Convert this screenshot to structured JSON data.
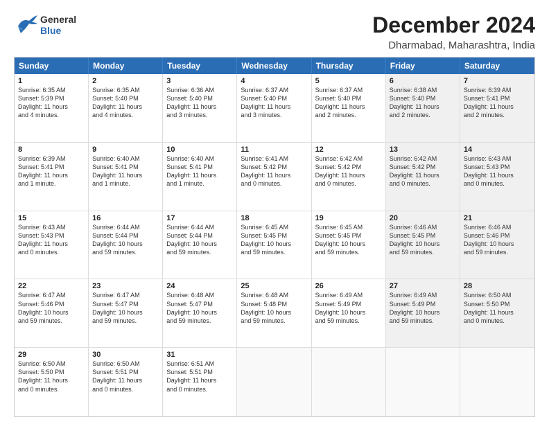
{
  "header": {
    "logo_general": "General",
    "logo_blue": "Blue",
    "main_title": "December 2024",
    "subtitle": "Dharmabad, Maharashtra, India"
  },
  "calendar": {
    "days_of_week": [
      "Sunday",
      "Monday",
      "Tuesday",
      "Wednesday",
      "Thursday",
      "Friday",
      "Saturday"
    ],
    "weeks": [
      [
        {
          "day": "1",
          "lines": [
            "Sunrise: 6:35 AM",
            "Sunset: 5:39 PM",
            "Daylight: 11 hours",
            "and 4 minutes."
          ],
          "shaded": false
        },
        {
          "day": "2",
          "lines": [
            "Sunrise: 6:35 AM",
            "Sunset: 5:40 PM",
            "Daylight: 11 hours",
            "and 4 minutes."
          ],
          "shaded": false
        },
        {
          "day": "3",
          "lines": [
            "Sunrise: 6:36 AM",
            "Sunset: 5:40 PM",
            "Daylight: 11 hours",
            "and 3 minutes."
          ],
          "shaded": false
        },
        {
          "day": "4",
          "lines": [
            "Sunrise: 6:37 AM",
            "Sunset: 5:40 PM",
            "Daylight: 11 hours",
            "and 3 minutes."
          ],
          "shaded": false
        },
        {
          "day": "5",
          "lines": [
            "Sunrise: 6:37 AM",
            "Sunset: 5:40 PM",
            "Daylight: 11 hours",
            "and 2 minutes."
          ],
          "shaded": false
        },
        {
          "day": "6",
          "lines": [
            "Sunrise: 6:38 AM",
            "Sunset: 5:40 PM",
            "Daylight: 11 hours",
            "and 2 minutes."
          ],
          "shaded": true
        },
        {
          "day": "7",
          "lines": [
            "Sunrise: 6:39 AM",
            "Sunset: 5:41 PM",
            "Daylight: 11 hours",
            "and 2 minutes."
          ],
          "shaded": true
        }
      ],
      [
        {
          "day": "8",
          "lines": [
            "Sunrise: 6:39 AM",
            "Sunset: 5:41 PM",
            "Daylight: 11 hours",
            "and 1 minute."
          ],
          "shaded": false
        },
        {
          "day": "9",
          "lines": [
            "Sunrise: 6:40 AM",
            "Sunset: 5:41 PM",
            "Daylight: 11 hours",
            "and 1 minute."
          ],
          "shaded": false
        },
        {
          "day": "10",
          "lines": [
            "Sunrise: 6:40 AM",
            "Sunset: 5:41 PM",
            "Daylight: 11 hours",
            "and 1 minute."
          ],
          "shaded": false
        },
        {
          "day": "11",
          "lines": [
            "Sunrise: 6:41 AM",
            "Sunset: 5:42 PM",
            "Daylight: 11 hours",
            "and 0 minutes."
          ],
          "shaded": false
        },
        {
          "day": "12",
          "lines": [
            "Sunrise: 6:42 AM",
            "Sunset: 5:42 PM",
            "Daylight: 11 hours",
            "and 0 minutes."
          ],
          "shaded": false
        },
        {
          "day": "13",
          "lines": [
            "Sunrise: 6:42 AM",
            "Sunset: 5:42 PM",
            "Daylight: 11 hours",
            "and 0 minutes."
          ],
          "shaded": true
        },
        {
          "day": "14",
          "lines": [
            "Sunrise: 6:43 AM",
            "Sunset: 5:43 PM",
            "Daylight: 11 hours",
            "and 0 minutes."
          ],
          "shaded": true
        }
      ],
      [
        {
          "day": "15",
          "lines": [
            "Sunrise: 6:43 AM",
            "Sunset: 5:43 PM",
            "Daylight: 11 hours",
            "and 0 minutes."
          ],
          "shaded": false
        },
        {
          "day": "16",
          "lines": [
            "Sunrise: 6:44 AM",
            "Sunset: 5:44 PM",
            "Daylight: 10 hours",
            "and 59 minutes."
          ],
          "shaded": false
        },
        {
          "day": "17",
          "lines": [
            "Sunrise: 6:44 AM",
            "Sunset: 5:44 PM",
            "Daylight: 10 hours",
            "and 59 minutes."
          ],
          "shaded": false
        },
        {
          "day": "18",
          "lines": [
            "Sunrise: 6:45 AM",
            "Sunset: 5:45 PM",
            "Daylight: 10 hours",
            "and 59 minutes."
          ],
          "shaded": false
        },
        {
          "day": "19",
          "lines": [
            "Sunrise: 6:45 AM",
            "Sunset: 5:45 PM",
            "Daylight: 10 hours",
            "and 59 minutes."
          ],
          "shaded": false
        },
        {
          "day": "20",
          "lines": [
            "Sunrise: 6:46 AM",
            "Sunset: 5:45 PM",
            "Daylight: 10 hours",
            "and 59 minutes."
          ],
          "shaded": true
        },
        {
          "day": "21",
          "lines": [
            "Sunrise: 6:46 AM",
            "Sunset: 5:46 PM",
            "Daylight: 10 hours",
            "and 59 minutes."
          ],
          "shaded": true
        }
      ],
      [
        {
          "day": "22",
          "lines": [
            "Sunrise: 6:47 AM",
            "Sunset: 5:46 PM",
            "Daylight: 10 hours",
            "and 59 minutes."
          ],
          "shaded": false
        },
        {
          "day": "23",
          "lines": [
            "Sunrise: 6:47 AM",
            "Sunset: 5:47 PM",
            "Daylight: 10 hours",
            "and 59 minutes."
          ],
          "shaded": false
        },
        {
          "day": "24",
          "lines": [
            "Sunrise: 6:48 AM",
            "Sunset: 5:47 PM",
            "Daylight: 10 hours",
            "and 59 minutes."
          ],
          "shaded": false
        },
        {
          "day": "25",
          "lines": [
            "Sunrise: 6:48 AM",
            "Sunset: 5:48 PM",
            "Daylight: 10 hours",
            "and 59 minutes."
          ],
          "shaded": false
        },
        {
          "day": "26",
          "lines": [
            "Sunrise: 6:49 AM",
            "Sunset: 5:49 PM",
            "Daylight: 10 hours",
            "and 59 minutes."
          ],
          "shaded": false
        },
        {
          "day": "27",
          "lines": [
            "Sunrise: 6:49 AM",
            "Sunset: 5:49 PM",
            "Daylight: 10 hours",
            "and 59 minutes."
          ],
          "shaded": true
        },
        {
          "day": "28",
          "lines": [
            "Sunrise: 6:50 AM",
            "Sunset: 5:50 PM",
            "Daylight: 11 hours",
            "and 0 minutes."
          ],
          "shaded": true
        }
      ],
      [
        {
          "day": "29",
          "lines": [
            "Sunrise: 6:50 AM",
            "Sunset: 5:50 PM",
            "Daylight: 11 hours",
            "and 0 minutes."
          ],
          "shaded": false
        },
        {
          "day": "30",
          "lines": [
            "Sunrise: 6:50 AM",
            "Sunset: 5:51 PM",
            "Daylight: 11 hours",
            "and 0 minutes."
          ],
          "shaded": false
        },
        {
          "day": "31",
          "lines": [
            "Sunrise: 6:51 AM",
            "Sunset: 5:51 PM",
            "Daylight: 11 hours",
            "and 0 minutes."
          ],
          "shaded": false
        },
        {
          "day": "",
          "lines": [],
          "shaded": false,
          "empty": true
        },
        {
          "day": "",
          "lines": [],
          "shaded": false,
          "empty": true
        },
        {
          "day": "",
          "lines": [],
          "shaded": true,
          "empty": true
        },
        {
          "day": "",
          "lines": [],
          "shaded": true,
          "empty": true
        }
      ]
    ]
  }
}
